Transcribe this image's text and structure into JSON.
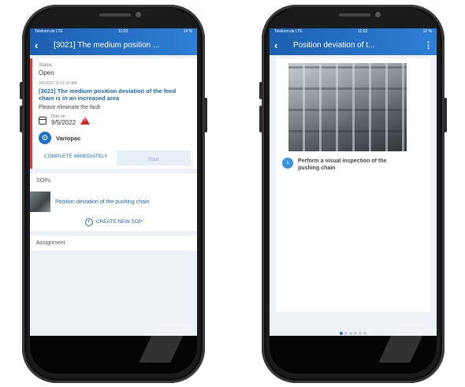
{
  "left_phone": {
    "status_bar": {
      "carrier": "Telekom.de  LTE",
      "time": "11:02",
      "battery": "14 %"
    },
    "app_bar": {
      "title": "[3021] The medium position ..."
    },
    "task": {
      "status_label": "Status",
      "status_value": "Open",
      "timestamp": "9/5/2022 11:01:30 AM",
      "description": "[3021] The medium position deviation of the feed chain is in an increased area",
      "hint": "Please eliminate the fault",
      "due_label": "Due on",
      "due_value": "9/5/2022",
      "machine": "Variopac",
      "complete_label": "COMPLETE IMMEDIATELY",
      "start_label": "Start"
    },
    "sops": {
      "title": "SOPs",
      "item": "Position deviation of the pushing chain",
      "create_label": "CREATE NEW SOP"
    },
    "assignment": {
      "title": "Assignment"
    }
  },
  "right_phone": {
    "status_bar": {
      "carrier": "Telekom.de  LTE",
      "time": "11:02",
      "battery": "12 %"
    },
    "app_bar": {
      "title": "Position deviation of t..."
    },
    "step": {
      "number": "1",
      "text": "Perform a visual inspection of the pushing chain"
    },
    "pagination": {
      "total": 6,
      "active": 1
    }
  },
  "icons": [
    "back-icon",
    "calendar-icon",
    "warning-icon",
    "gear-icon",
    "add-icon",
    "kebab-menu-icon"
  ],
  "colors": {
    "primary": "#1d6fc7",
    "alert": "#d8232a"
  }
}
